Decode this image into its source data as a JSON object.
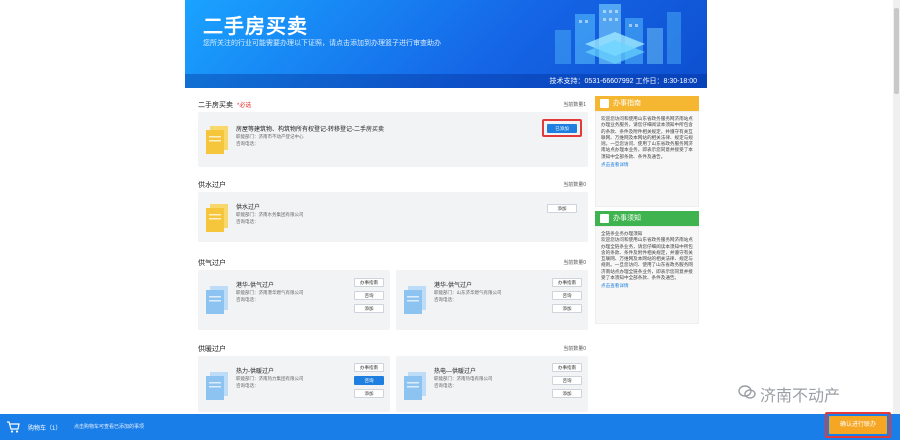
{
  "banner": {
    "title": "二手房买卖",
    "subtitle": "您所关注的行业可能需要办理以下证照，请点击添加到办理篮子进行审查助办",
    "support": "技术支持：0531-66607992  工作日：8:30-18:00"
  },
  "sections": [
    {
      "title": "二手房买卖",
      "required": "*必选",
      "count": "当前数量1",
      "cards": [
        {
          "title": "房屋等建筑物、构筑物所有权登记-转移登记-二手房买卖",
          "dept": "职能部门：济南市不动产登记中心",
          "phone": "咨询电话：",
          "buttons": [
            "已添加"
          ]
        }
      ]
    },
    {
      "title": "供水过户",
      "count": "当前数量0",
      "cards": [
        {
          "title": "供水过户",
          "dept": "职能部门：济南水务集团有限公司",
          "phone": "咨询电话：",
          "buttons": [
            "添加"
          ]
        }
      ]
    },
    {
      "title": "供气过户",
      "count": "当前数量0",
      "cards": [
        {
          "title": "港华-供气过户",
          "dept": "职能部门：济南港华燃气有限公司",
          "phone": "咨询电话：",
          "buttons": [
            "办事指南",
            "咨询",
            "添加"
          ]
        },
        {
          "title": "港华-供气过户",
          "dept": "职能部门：山东济华燃气有限公司",
          "phone": "咨询电话：",
          "buttons": [
            "办事指南",
            "咨询",
            "添加"
          ]
        }
      ]
    },
    {
      "title": "供暖过户",
      "count": "当前数量0",
      "cards": [
        {
          "title": "热力-供暖过户",
          "dept": "职能部门：济南热力集团有限公司",
          "phone": "咨询电话：",
          "buttons": [
            "办事指南",
            "咨询",
            "添加"
          ]
        },
        {
          "title": "热电—供暖过户",
          "dept": "职能部门：济南热电有限公司",
          "phone": "咨询电话：",
          "buttons": [
            "办事指南",
            "咨询",
            "添加"
          ]
        }
      ]
    }
  ],
  "sidebar": {
    "guide": {
      "title": "办事指南",
      "text": "欢迎您访问和使用山东省政务服务网济南站点办理业务服务，请您仔细阅读本须知中所包含的条款、条件及附件相关规定，并遵守有关互联网、万维网及本网站的相关法律、规定与规则。一旦您访问、使用了山东省政务服务网济南站点办理本业务，即表示您同意并接受了本须知中全部条款、条件及通告。",
      "link": "点击查看详情"
    },
    "notice": {
      "title": "办事须知",
      "heading": "全链条业务办理须知",
      "text": "欢迎您访问和使用山东省政务服务网济南站点办理全链条业务，请您仔细阅读本须知中所包含的条款、条件及附件相关规定，并遵守有关互联网、万维网及本网站的相关法律、规定与规则。一旦您访问、使用了山东省政务服务网济南站点办理全链条业务，即表示您同意并接受了本须知中全部条款、条件及通告。",
      "link": "点击查看详情"
    }
  },
  "cart": {
    "label": "购物车（1）",
    "hint": "点击购物车可查看已添加的事项",
    "confirm": "确认进行联办"
  },
  "watermark": "济南不动产",
  "colors": {
    "primary": "#1e7fe0",
    "banner": "#1565e6",
    "guide_header": "#f5b731",
    "notice_header": "#3fb34f",
    "confirm": "#f5a623",
    "highlight": "#e23a3a"
  }
}
